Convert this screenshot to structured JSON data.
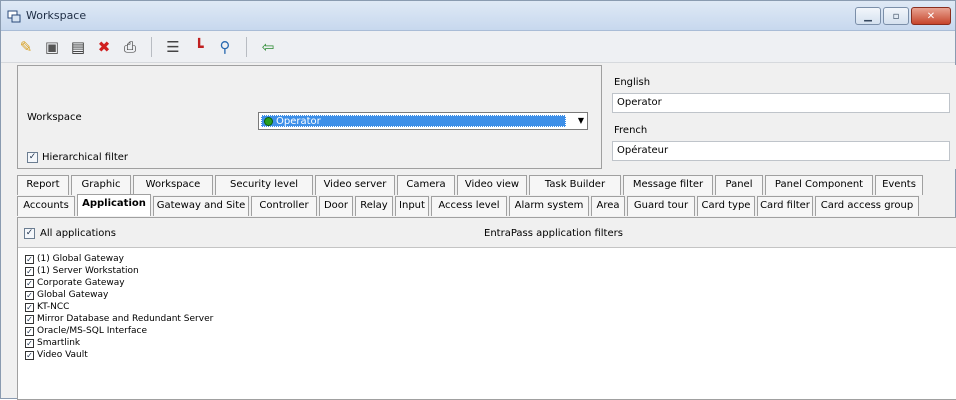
{
  "window": {
    "title": "Workspace"
  },
  "toolbar": {
    "icons": [
      "new-icon",
      "save-icon",
      "save-as-icon",
      "delete-icon",
      "print-icon",
      "list-icon",
      "link-icon",
      "search-icon",
      "exit-icon"
    ]
  },
  "workspace": {
    "label": "Workspace",
    "value": "Operator"
  },
  "hierarchical_filter": {
    "label": "Hierarchical filter",
    "checked": true
  },
  "languages": {
    "english_label": "English",
    "english_value": "Operator",
    "french_label": "French",
    "french_value": "Opérateur"
  },
  "tabs_row1": [
    "Report",
    "Graphic",
    "Workspace",
    "Security level",
    "Video server",
    "Camera",
    "Video view",
    "Task Builder",
    "Message filter",
    "Panel",
    "Panel Component",
    "Events"
  ],
  "tabs_row2": [
    "Accounts",
    "Application",
    "Gateway and Site",
    "Controller",
    "Door",
    "Relay",
    "Input",
    "Access level",
    "Alarm system",
    "Area",
    "Guard tour",
    "Card type",
    "Card filter",
    "Card access group"
  ],
  "active_tab": "Application",
  "content": {
    "all_applications_label": "All applications",
    "filters_title": "EntraPass application filters",
    "applications": [
      "(1)  Global Gateway",
      "(1)  Server Workstation",
      "Corporate Gateway",
      "Global Gateway",
      "KT-NCC",
      "Mirror Database and Redundant Server",
      "Oracle/MS-SQL Interface",
      "Smartlink",
      "Video Vault"
    ]
  }
}
